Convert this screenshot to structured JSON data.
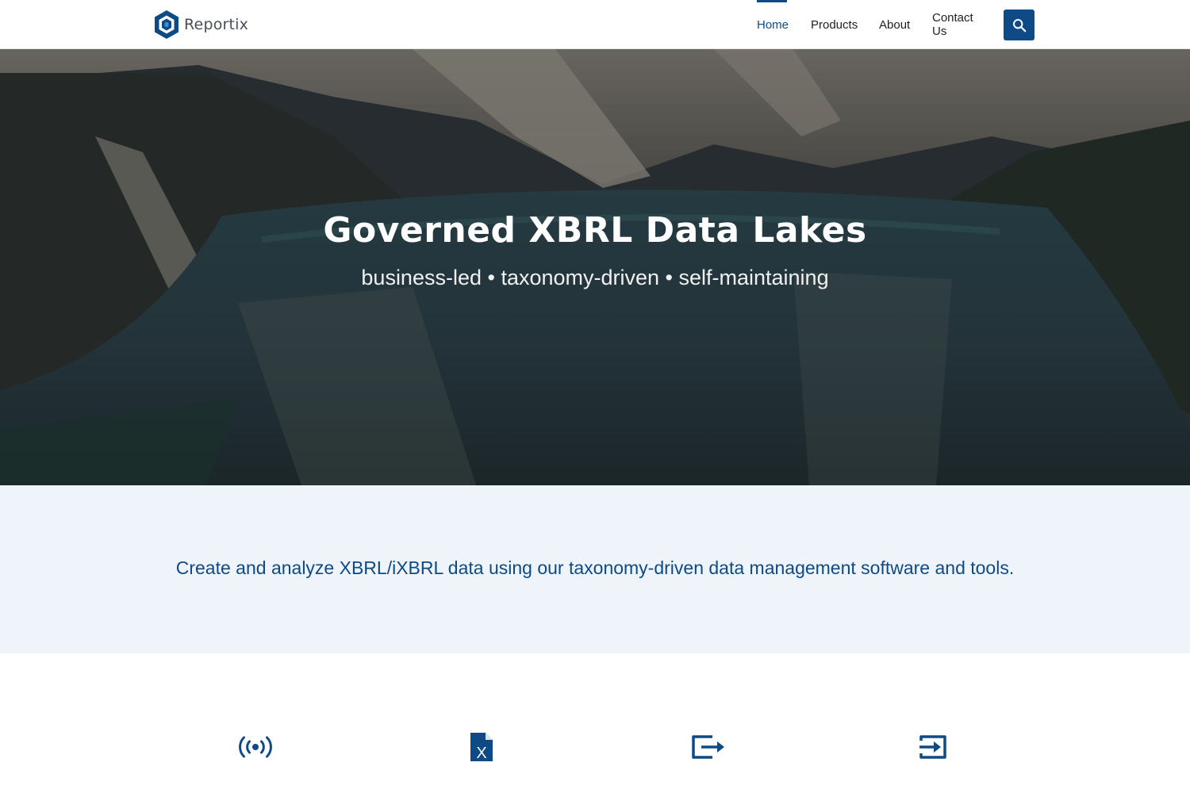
{
  "brand": {
    "name": "Reportix",
    "accent_color": "#0e4a86"
  },
  "nav": {
    "items": [
      {
        "label": "Home",
        "active": true
      },
      {
        "label": "Products",
        "active": false
      },
      {
        "label": "About",
        "active": false
      },
      {
        "label": "Contact Us",
        "active": false
      }
    ],
    "search_icon": "search-icon"
  },
  "hero": {
    "title": "Governed XBRL Data Lakes",
    "subtitle": "business-led • taxonomy-driven • self-maintaining",
    "background": "mountain lake aerial photo"
  },
  "intro": {
    "text": "Create and analyze XBRL/iXBRL data using our taxonomy-driven data management software and tools."
  },
  "features": [
    {
      "icon": "broadcast-icon"
    },
    {
      "icon": "xbrl-file-icon",
      "glyph": "X"
    },
    {
      "icon": "export-icon"
    },
    {
      "icon": "import-icon"
    }
  ]
}
